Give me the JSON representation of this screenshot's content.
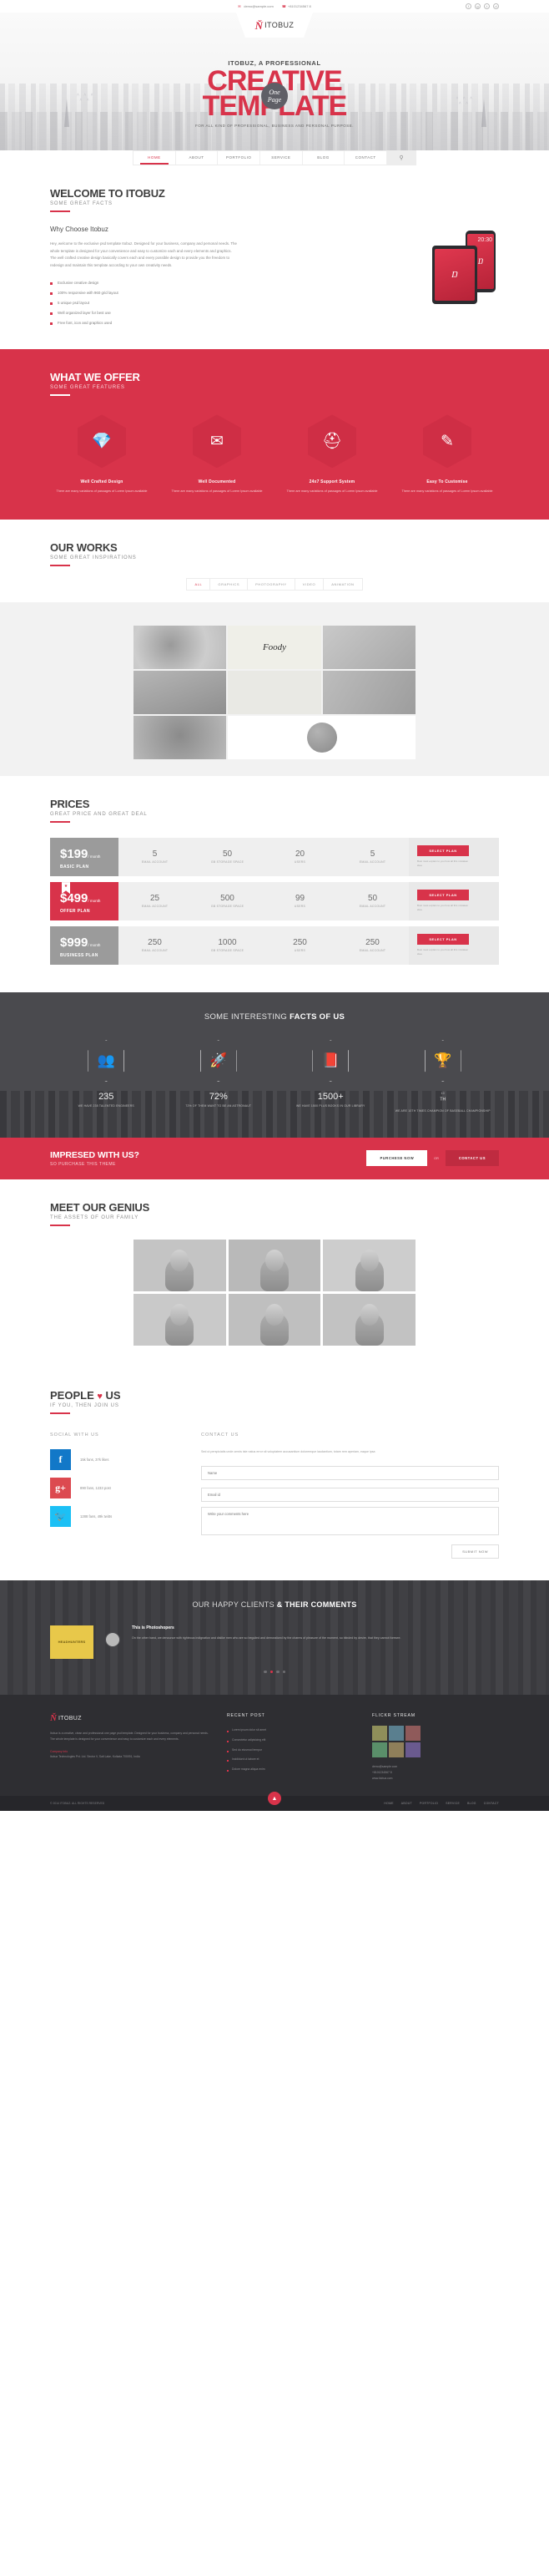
{
  "topbar": {
    "email": "demo@sample.com",
    "phone": "+8101234567 8",
    "email_icon": "envelope-icon",
    "phone_icon": "phone-icon",
    "social": [
      {
        "name": "facebook-icon",
        "glyph": "f"
      },
      {
        "name": "google-plus-icon",
        "glyph": "g"
      },
      {
        "name": "twitter-icon",
        "glyph": "t"
      },
      {
        "name": "dribbble-icon",
        "glyph": "d"
      }
    ]
  },
  "brand": {
    "mark": "Ň",
    "name": "ITOBUZ"
  },
  "hero": {
    "pretitle": "ITOBUZ, A PROFESSIONAL",
    "line1": "CREATIVE",
    "line2": "TEMPLATE",
    "subtitle": "FOR ALL KIND OF PROFESSIONAL, BUSINESS AND PERSONAL PURPOSE.",
    "badge_line1": "One",
    "badge_line2": "Page"
  },
  "nav": {
    "items": [
      {
        "label": "HOME",
        "active": true
      },
      {
        "label": "ABOUT",
        "active": false
      },
      {
        "label": "PORTFOLIO",
        "active": false
      },
      {
        "label": "SERVICE",
        "active": false
      },
      {
        "label": "BLOG",
        "active": false
      },
      {
        "label": "CONTACT",
        "active": false
      }
    ],
    "search_icon": "search-icon"
  },
  "welcome": {
    "title": "WELCOME TO ITOBUZ",
    "subtitle": "SOME GREAT FACTS",
    "heading": "Why Choose Itobuz",
    "paragraph": "Hey, welcome to the exclusive psd template Itobuz. Designed for your business, company and personal needs. The whole template is designed for your convenience and easy to customize each and every elements and graphics. The well crafted creative design basically covers each and every possible design to provide you the freedom to redesign and maintain this template according to your own creativity needs.",
    "list": [
      "Exclusive creative design",
      "100% responsive with 960 grid layout",
      "5 unique psd layout",
      "Well organized layer for best use",
      "Free font, icon and graphics used"
    ],
    "device_clock": "20:30"
  },
  "offer": {
    "title": "WHAT WE OFFER",
    "subtitle": "SOME GREAT FEATURES",
    "features": [
      {
        "icon": "diamond-icon",
        "glyph": "💎",
        "title": "Well Crafted Design",
        "text": "There are many variations of passages of Lorem Ipsum available"
      },
      {
        "icon": "envelope-icon",
        "glyph": "✉",
        "title": "Well Documented",
        "text": "There are many variations of passages of Lorem Ipsum available"
      },
      {
        "icon": "lifebuoy-icon",
        "glyph": "⛑",
        "title": "24x7 Support System",
        "text": "There are many variations of passages of Lorem Ipsum available"
      },
      {
        "icon": "pencil-icon",
        "glyph": "✎",
        "title": "Easy To Customise",
        "text": "There are many variations of passages of Lorem Ipsum available"
      }
    ]
  },
  "works": {
    "title": "OUR WORKS",
    "subtitle": "SOME GREAT INSPIRATIONS",
    "filters": [
      {
        "label": "ALL",
        "active": true
      },
      {
        "label": "GRAPHICS",
        "active": false
      },
      {
        "label": "PHOTOGRAPHY",
        "active": false
      },
      {
        "label": "VIDEO",
        "active": false
      },
      {
        "label": "ANIMATION",
        "active": false
      }
    ],
    "tiles": [
      {
        "name": "work-plate-photo",
        "caption": ""
      },
      {
        "name": "work-foody-lettering",
        "caption": "Foody"
      },
      {
        "name": "work-bread-photo",
        "caption": ""
      },
      {
        "name": "work-portrait-photo",
        "caption": ""
      },
      {
        "name": "work-magazine-photo",
        "caption": ""
      },
      {
        "name": "work-food-photo",
        "caption": ""
      },
      {
        "name": "work-coffee-photo",
        "caption": ""
      },
      {
        "name": "work-cookie-photo",
        "caption": ""
      }
    ]
  },
  "prices": {
    "title": "PRICES",
    "subtitle": "GREAT PRICE AND GREAT DEAL",
    "button_label": "SELECT PLAN",
    "note": "Bust must explain to you how all this mistaken idea",
    "plans": [
      {
        "price": "$199",
        "per": "/ month",
        "name": "BASIC PLAN",
        "featured": false,
        "specs": [
          {
            "value": "5",
            "label": "EMAIL ACCOUNT"
          },
          {
            "value": "50",
            "label": "GB STORAGE SPACE"
          },
          {
            "value": "20",
            "label": "USERS"
          },
          {
            "value": "5",
            "label": "EMAIL ACCOUNT"
          }
        ]
      },
      {
        "price": "$499",
        "per": "/ month",
        "name": "OFFER PLAN",
        "featured": true,
        "specs": [
          {
            "value": "25",
            "label": "EMAIL ACCOUNT"
          },
          {
            "value": "500",
            "label": "GB STORAGE SPACE"
          },
          {
            "value": "99",
            "label": "USERS"
          },
          {
            "value": "50",
            "label": "EMAIL ACCOUNT"
          }
        ]
      },
      {
        "price": "$999",
        "per": "/ month",
        "name": "BUSINESS PLAN",
        "featured": false,
        "specs": [
          {
            "value": "250",
            "label": "EMAIL ACCOUNT"
          },
          {
            "value": "1000",
            "label": "GB STORAGE SPACE"
          },
          {
            "value": "250",
            "label": "USERS"
          },
          {
            "value": "250",
            "label": "EMAIL ACCOUNT"
          }
        ]
      }
    ]
  },
  "facts": {
    "heading_light": "SOME INTERESTING ",
    "heading_bold": "FACTS OF US",
    "items": [
      {
        "icon": "users-icon",
        "glyph": "👥",
        "value": "235",
        "sup": "",
        "text": "WE HAVE 235 TALENTED ENGINEERS"
      },
      {
        "icon": "rocket-icon",
        "glyph": "🚀",
        "value": "72%",
        "sup": "",
        "text": "72% OF THEM WANT TO BE AN ASTRONAUT"
      },
      {
        "icon": "book-icon",
        "glyph": "📕",
        "value": "1500+",
        "sup": "",
        "text": "WE HAVE 1500 PLUS BOOKS IN OUR LIBRARY"
      },
      {
        "icon": "trophy-icon",
        "glyph": "🏆",
        "value": "10",
        "sup": "TH",
        "text": "WE ARE 10TH TIMES CHAMPION OF BASEBALL CHAMPIONSHIP"
      }
    ]
  },
  "cta": {
    "title": "IMPRESED WITH US?",
    "subtitle": "SO PURCHASE THIS THEME",
    "primary": "PURCHESE NOW",
    "or": "OR",
    "secondary": "CONTACT US"
  },
  "team": {
    "title": "MEET OUR GENIUS",
    "subtitle": "THE ASSETS OF OUR FAMILY",
    "members": [
      {
        "name": "team-member-1"
      },
      {
        "name": "team-member-2"
      },
      {
        "name": "team-member-3"
      },
      {
        "name": "team-member-4"
      },
      {
        "name": "team-member-5"
      },
      {
        "name": "team-member-6"
      }
    ]
  },
  "love": {
    "title_a": "PEOPLE ",
    "heart": "♥",
    "title_b": " US",
    "subtitle": "IF YOU, THEN JOIN US",
    "social_heading": "SOCIAL WITH US",
    "contact_heading": "CONTACT US",
    "contact_text": "Sed ut perspiciatis unde omnis iste natus error sit voluptatem accusantium doloremque laudantium, totam rem aperiam, eaque ipsa",
    "socials": [
      {
        "name": "facebook",
        "glyph": "f",
        "stats": "15k fans, 37k likes"
      },
      {
        "name": "google-plus",
        "glyph": "g+",
        "stats": "890 fans, 1233 post"
      },
      {
        "name": "twitter",
        "glyph": "🐦",
        "stats": "1288 fans, 49k twitts"
      }
    ],
    "form": {
      "name_placeholder": "Name",
      "email_placeholder": "Email id",
      "comment_placeholder": "Write your comments here",
      "submit_label": "SUBMIT NOW"
    }
  },
  "testimonial": {
    "heading_light": "OUR HAPPY CLIENTS ",
    "heading_bold": "& THEIR COMMENTS",
    "badge": "HEADHUNTERS",
    "author": "This is Photoshopers",
    "quote": "On the other hand, we denounce with righteous indignation and dislike men who are so beguiled and demoralized by the charms of pleasure of the moment, so blinded by desire, that they cannot foresee.",
    "dots": 4,
    "active_dot": 1
  },
  "footer": {
    "about_text": "Itobuz is a creative, clean and professional one page psd template. Designed for your business, company and personal needs. The whole template is designed for your convenience and easy to customize each and every elements.",
    "company_label": "Company Info",
    "company_text": "Itobuz Technologies Pvt. Ltd. Sector V, Salt Lake, Kolkata 700091, India",
    "recent_heading": "RECENT POST",
    "recent_posts": [
      "Lorem ipsum dolor sit amet",
      "Consectetur adipisicing elit",
      "Sed do eiusmod tempor",
      "Incididunt ut labore et",
      "Dolore magna aliqua enim"
    ],
    "flickr_heading": "FLICKR STREAM",
    "flickr_thumbs": 6,
    "contact_lines": [
      "demo@sample.com",
      "+8101234567 8",
      "www.itobuz.com"
    ],
    "copyright": "© 2014 ITOBUZ. ALL RIGHTS RESERVED",
    "nav": [
      "HOME",
      "ABOUT",
      "PORTFOLIO",
      "SERVICE",
      "BLOG",
      "CONTACT"
    ],
    "totop_icon": "arrow-up-icon"
  }
}
